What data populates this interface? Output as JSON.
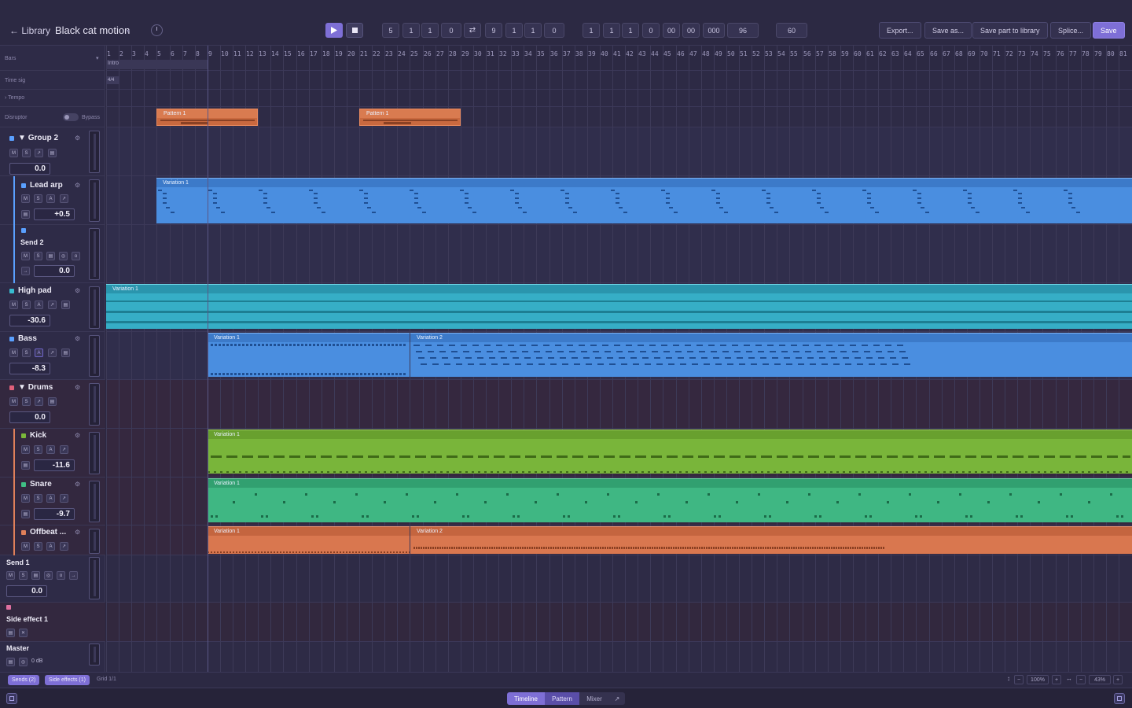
{
  "header": {
    "back_label": "Library",
    "song_title": "Black cat motion",
    "position_fields": [
      "5",
      "1",
      "1",
      "0"
    ],
    "loop_fields": [
      "9",
      "1",
      "1",
      "0"
    ],
    "time_fields": [
      "1",
      "1",
      "1",
      "0",
      "00",
      "00",
      "000"
    ],
    "ppq": "96",
    "tempo": "60",
    "buttons": {
      "export": "Export...",
      "save_as": "Save as...",
      "save_part": "Save part to library",
      "splice": "Splice...",
      "save": "Save"
    }
  },
  "lanes": {
    "bars_label": "Bars",
    "intro_marker": "Intro",
    "time_sig_label": "Time sig",
    "time_sig_value": "4/4",
    "tempo_label": "Tempo",
    "disruptor_label": "Disruptor",
    "bypass_label": "Bypass"
  },
  "ruler": {
    "bars": [
      "1",
      "2",
      "3",
      "4",
      "5",
      "6",
      "7",
      "8",
      "9",
      "10",
      "11",
      "12",
      "13",
      "14",
      "15",
      "16",
      "17",
      "18",
      "19",
      "20",
      "21",
      "22",
      "23",
      "24",
      "25",
      "26",
      "27",
      "28",
      "29",
      "30",
      "31",
      "32",
      "33",
      "34",
      "35",
      "36",
      "37",
      "38",
      "39",
      "40",
      "41",
      "42",
      "43",
      "44",
      "45",
      "46",
      "47",
      "48",
      "49",
      "50",
      "51",
      "52",
      "53",
      "54",
      "55",
      "56",
      "57",
      "58",
      "59",
      "60",
      "61",
      "62",
      "63",
      "64",
      "65",
      "66",
      "67",
      "68",
      "69",
      "70",
      "71",
      "72",
      "73",
      "74",
      "75",
      "76",
      "77",
      "78",
      "79",
      "80",
      "81"
    ]
  },
  "tracks": {
    "group2": {
      "name": "Group 2",
      "volume": "0.0",
      "color": "#5aa0ff"
    },
    "lead_arp": {
      "name": "Lead arp",
      "volume": "+0.5",
      "color": "#5aa0ff"
    },
    "send2": {
      "name": "Send 2",
      "volume": "0.0",
      "color": "#5aa0ff"
    },
    "high_pad": {
      "name": "High pad",
      "volume": "-30.6",
      "color": "#38bcd0"
    },
    "bass": {
      "name": "Bass",
      "volume": "-8.3",
      "color": "#5aa0ff"
    },
    "drums": {
      "name": "Drums",
      "volume": "0.0",
      "color": "#e0607a"
    },
    "kick": {
      "name": "Kick",
      "volume": "-11.6",
      "color": "#7ab83a"
    },
    "snare": {
      "name": "Snare",
      "volume": "-9.7",
      "color": "#3fbf85"
    },
    "offbeat": {
      "name": "Offbeat ...",
      "color": "#e0805a"
    },
    "send1": {
      "name": "Send 1",
      "volume": "0.0"
    },
    "side_effect1": {
      "name": "Side effect 1",
      "color": "#e070a0"
    },
    "master": {
      "name": "Master",
      "volume": "0 dB"
    }
  },
  "clips": {
    "disruptor_a": "Pattern 1",
    "disruptor_b": "Pattern 1",
    "lead_arp": "Variation 1",
    "high_pad": "Variation 1",
    "bass_a": "Variation 1",
    "bass_b": "Variation 2",
    "kick": "Variation 1",
    "snare": "Variation 1",
    "offbeat_a": "Variation 1",
    "offbeat_b": "Variation 2"
  },
  "footer": {
    "sends_pill": "Sends (2)",
    "side_effects_pill": "Side effects (1)",
    "grid_label": "Grid 1/1",
    "zoom_h": "100%",
    "zoom_v": "43%",
    "tabs": {
      "timeline": "Timeline",
      "pattern": "Pattern",
      "mixer": "Mixer"
    }
  },
  "colors": {
    "accent": "#7e6fd6",
    "clip_blue": "#4a8ee0",
    "clip_cyan": "#36aec6",
    "clip_green": "#79b53a",
    "clip_teal": "#3fb783",
    "clip_orange": "#d9774f"
  }
}
